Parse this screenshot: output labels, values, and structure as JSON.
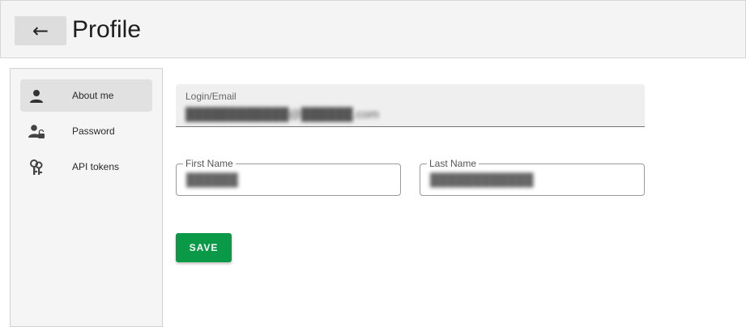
{
  "header": {
    "back_icon": "arrow-left-icon",
    "back_glyph": "←",
    "title": "Profile"
  },
  "sidebar": {
    "items": [
      {
        "label": "About me",
        "icon": "person-icon",
        "active": true
      },
      {
        "label": "Password",
        "icon": "person-lock-icon",
        "active": false
      },
      {
        "label": "API tokens",
        "icon": "keys-icon",
        "active": false
      }
    ]
  },
  "form": {
    "login": {
      "label": "Login/Email",
      "value": "████████████@██████.com"
    },
    "first_name": {
      "label": "First Name",
      "value": "██████"
    },
    "last_name": {
      "label": "Last Name",
      "value": "████████████"
    },
    "save_label": "SAVE"
  },
  "colors": {
    "accent": "#0a9a47",
    "header_bg": "#f4f4f4",
    "sidebar_bg": "#f5f5f5",
    "active_item_bg": "#e1e1e1"
  }
}
